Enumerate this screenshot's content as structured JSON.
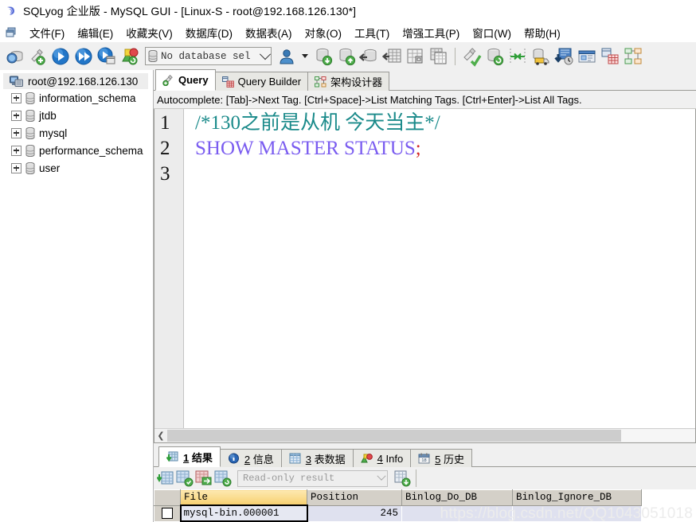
{
  "window": {
    "title": "SQLyog 企业版 - MySQL GUI - [Linux-S - root@192.168.126.130*]",
    "icon": "sqlyog-app-icon"
  },
  "menubar": {
    "icon": "window-restore-icon",
    "items": [
      {
        "label": "文件(F)",
        "name": "menu-file"
      },
      {
        "label": "编辑(E)",
        "name": "menu-edit"
      },
      {
        "label": "收藏夹(V)",
        "name": "menu-favorites"
      },
      {
        "label": "数据库(D)",
        "name": "menu-database"
      },
      {
        "label": "数据表(A)",
        "name": "menu-table"
      },
      {
        "label": "对象(O)",
        "name": "menu-objects"
      },
      {
        "label": "工具(T)",
        "name": "menu-tools"
      },
      {
        "label": "增强工具(P)",
        "name": "menu-powertools"
      },
      {
        "label": "窗口(W)",
        "name": "menu-window"
      },
      {
        "label": "帮助(H)",
        "name": "menu-help"
      }
    ]
  },
  "toolbar": {
    "database_select": {
      "value": "No database sel",
      "icon": "database-icon"
    },
    "buttons": [
      {
        "name": "new-connection-icon"
      },
      {
        "name": "new-query-tab-icon"
      },
      {
        "name": "execute-query-icon"
      },
      {
        "name": "execute-all-queries-icon"
      },
      {
        "name": "execute-query-new-tab-icon"
      },
      {
        "name": "stop-execution-icon"
      },
      {
        "name": "user-manager-icon"
      },
      {
        "name": "backup-database-icon"
      },
      {
        "name": "restore-database-icon"
      },
      {
        "name": "import-external-data-icon"
      },
      {
        "name": "export-table-data-icon"
      },
      {
        "name": "create-table-icon"
      },
      {
        "name": "copy-table-icon"
      },
      {
        "name": "sql-formatter-icon"
      },
      {
        "name": "database-sync-icon"
      },
      {
        "name": "schema-sync-icon"
      },
      {
        "name": "data-transfer-icon"
      },
      {
        "name": "notifications-icon"
      },
      {
        "name": "scheduler-icon"
      },
      {
        "name": "query-builder-icon"
      },
      {
        "name": "schema-designer-icon"
      }
    ]
  },
  "sidebar": {
    "root": {
      "label": "root@192.168.126.130",
      "icon": "server-icon"
    },
    "databases": [
      {
        "label": "information_schema",
        "icon": "database-icon"
      },
      {
        "label": "jtdb",
        "icon": "database-icon"
      },
      {
        "label": "mysql",
        "icon": "database-icon"
      },
      {
        "label": "performance_schema",
        "icon": "database-icon"
      },
      {
        "label": "user",
        "icon": "database-icon"
      }
    ]
  },
  "editor_tabs": [
    {
      "label": "Query",
      "icon": "query-icon",
      "active": true
    },
    {
      "label": "Query Builder",
      "icon": "query-builder-icon",
      "active": false
    },
    {
      "label": "架构设计器",
      "icon": "schema-designer-icon",
      "active": false
    }
  ],
  "autocomplete_hint": "Autocomplete: [Tab]->Next Tag. [Ctrl+Space]->List Matching Tags. [Ctrl+Enter]->List All Tags.",
  "editor": {
    "line_numbers": [
      "1",
      "2",
      "3"
    ],
    "lines": [
      {
        "comment": "/*130之前是从机 今天当主*/"
      },
      {
        "keyword": "SHOW MASTER STATUS",
        "punct": ";"
      },
      {
        "empty": ""
      }
    ],
    "colors": {
      "comment": "#1a8a8a",
      "keyword": "#7a5cf0",
      "punctuation": "#d42a2a"
    }
  },
  "result_tabs": [
    {
      "num": "1",
      "label": "结果",
      "icon": "result-grid-icon",
      "active": true
    },
    {
      "num": "2",
      "label": "信息",
      "icon": "info-icon",
      "active": false
    },
    {
      "num": "3",
      "label": "表数据",
      "icon": "table-data-icon",
      "active": false
    },
    {
      "num": "4",
      "label": "Info",
      "icon": "objects-info-icon",
      "active": false
    },
    {
      "num": "5",
      "label": "历史",
      "icon": "history-icon",
      "active": false
    }
  ],
  "result_toolbar": {
    "mode_select": {
      "value": "Read-only result"
    },
    "buttons": [
      {
        "name": "insert-row-icon"
      },
      {
        "name": "save-changes-icon"
      },
      {
        "name": "refresh-data-icon"
      },
      {
        "name": "apply-changes-icon"
      },
      {
        "name": "export-results-icon"
      }
    ]
  },
  "result_grid": {
    "columns": [
      "File",
      "Position",
      "Binlog_Do_DB",
      "Binlog_Ignore_DB"
    ],
    "highlighted_column": "File",
    "rows": [
      {
        "selected": true,
        "File": "mysql-bin.000001",
        "Position": "245",
        "Binlog_Do_DB": "",
        "Binlog_Ignore_DB": ""
      }
    ]
  },
  "watermark": "https://blog.csdn.net/QQ1043051018"
}
